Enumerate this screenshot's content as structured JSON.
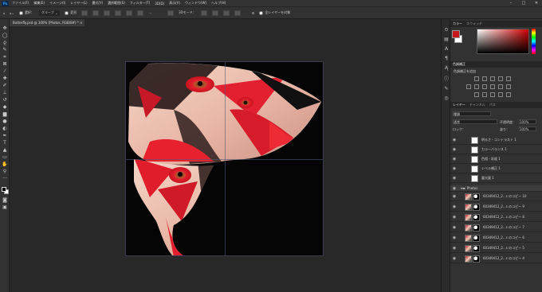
{
  "app": {
    "logo": "Ps"
  },
  "menu": [
    "ファイル(F)",
    "編集(E)",
    "イメージ(I)",
    "レイヤー(L)",
    "書式(Y)",
    "選択範囲(S)",
    "フィルター(T)",
    "3D(D)",
    "表示(V)",
    "ウィンドウ(W)",
    "ヘルプ(H)"
  ],
  "window_controls": [
    "–",
    "□",
    "✕"
  ],
  "options": {
    "auto_select": "選択：",
    "auto_select_value": "グループ",
    "transform": "変形",
    "mode_3d": "3Dモード：",
    "sample_all": "全レイヤーを対象"
  },
  "document_tab": {
    "label": "Butterfly.psd @ 100% (Photos, RGB/8#) *",
    "close": "✕"
  },
  "panels": {
    "color_tabs": [
      "カラー",
      "スウォッチ"
    ],
    "adjust_tabs": [
      "色調補正"
    ],
    "adjust_label": "色調補正を追加",
    "layer_tabs": [
      "レイヤー",
      "チャンネル",
      "パス"
    ],
    "kind": "種類",
    "blend_mode": "通常",
    "opacity_label": "不透明度：",
    "opacity_value": "100%",
    "lock_label": "ロック：",
    "fill_label": "塗り：",
    "fill_value": "100%"
  },
  "layers": [
    {
      "name": "明るさ・コントラスト 1"
    },
    {
      "name": "カラーバランス 1"
    },
    {
      "name": "色相・彩度 1"
    },
    {
      "name": "レベル補正 1"
    },
    {
      "name": "露光量 1"
    },
    {
      "name": "Photos"
    },
    {
      "name": "60349412_2...s のコピー 10"
    },
    {
      "name": "60349412_2...s のコピー 9"
    },
    {
      "name": "60349412_2...s のコピー 8"
    },
    {
      "name": "60349412_2...s のコピー 7"
    },
    {
      "name": "60349412_2...s のコピー 6"
    },
    {
      "name": "60349412_2...s のコピー 5"
    },
    {
      "name": "60349412_2...s のコピー 4"
    }
  ],
  "colors": {
    "foreground": "#c8161d",
    "background": "#ffffff",
    "accent": "#31a8ff"
  }
}
